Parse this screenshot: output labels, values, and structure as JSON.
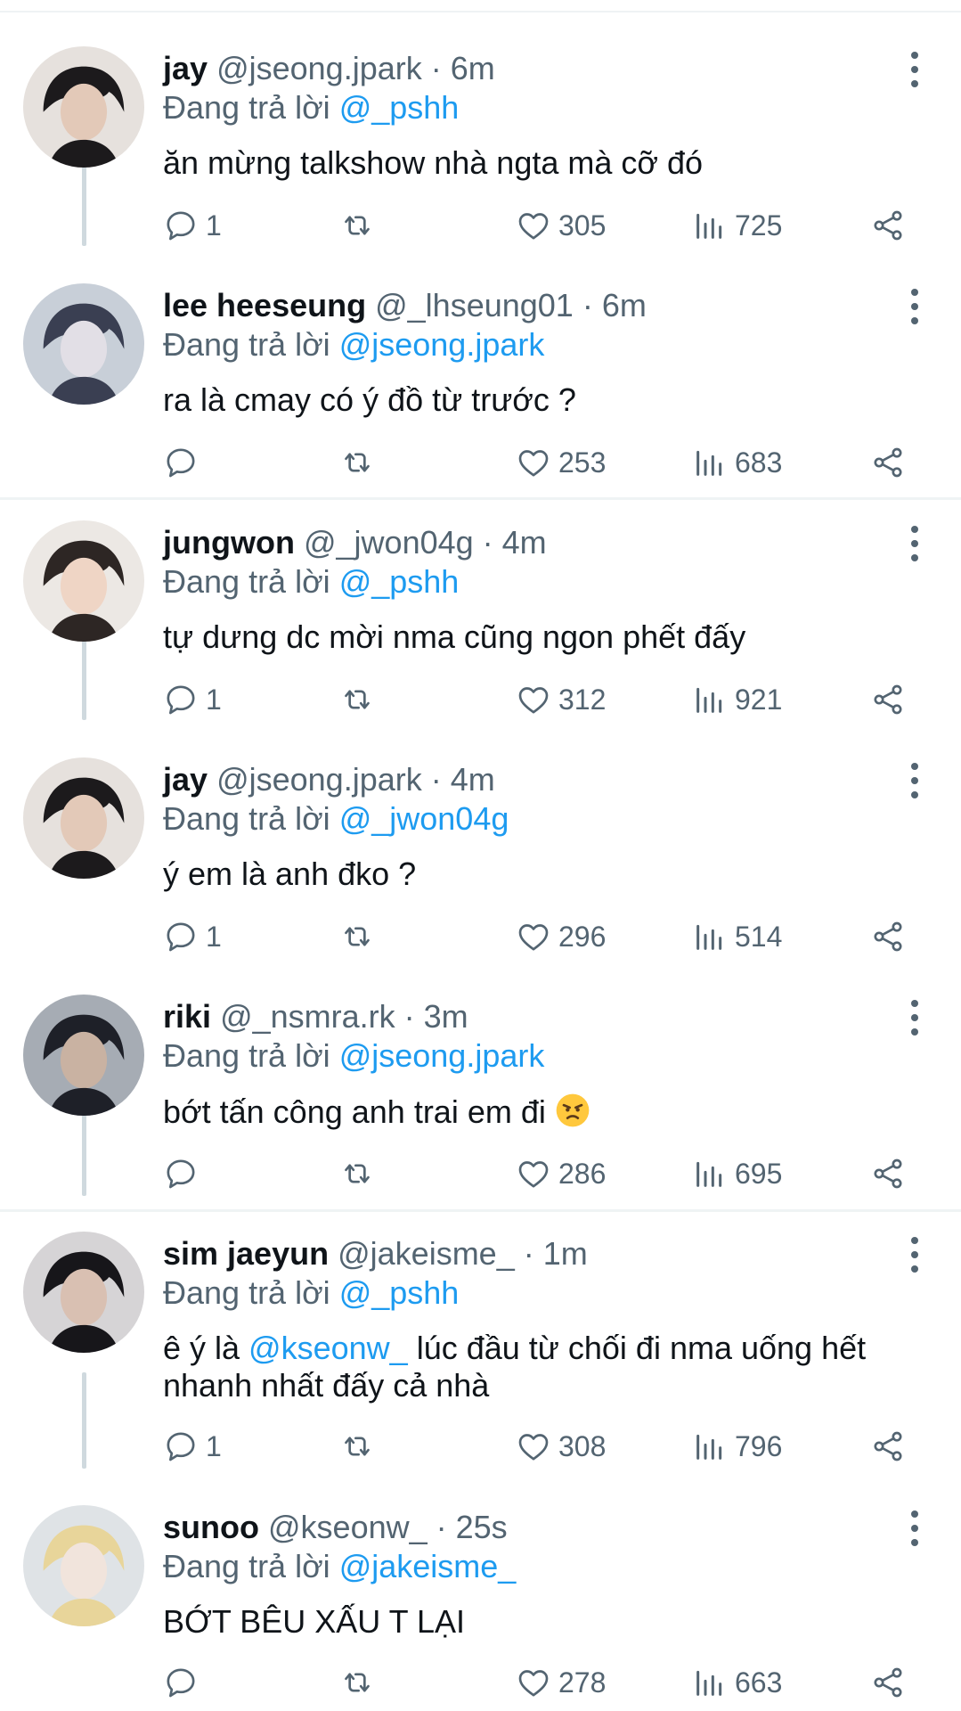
{
  "tweets": [
    {
      "name": "jay",
      "handle": "@jseong.jpark",
      "time": "6m",
      "reply_prefix": "Đang trả lời",
      "reply_to": "@_pshh",
      "text_before": "ăn mừng talkshow nhà ngta mà cỡ đó",
      "mention": "",
      "text_after": "",
      "emoji": "",
      "replies": "1",
      "likes": "305",
      "views": "725",
      "avatar_colors": [
        "#e6e1dd",
        "#1c1a1c",
        "#e3c9b8"
      ]
    },
    {
      "name": "lee heeseung",
      "handle": "@_lhseung01",
      "time": "6m",
      "reply_prefix": "Đang trả lời",
      "reply_to": "@jseong.jpark",
      "text_before": "ra là cmay có ý đồ từ trước ?",
      "mention": "",
      "text_after": "",
      "emoji": "",
      "replies": "",
      "likes": "253",
      "views": "683",
      "avatar_colors": [
        "#c8cfd8",
        "#3a3f52",
        "#e2dfe6"
      ]
    },
    {
      "name": "jungwon",
      "handle": "@_jwon04g",
      "time": "4m",
      "reply_prefix": "Đang trả lời",
      "reply_to": "@_pshh",
      "text_before": "tự dưng dc mời nma cũng ngon phết đấy",
      "mention": "",
      "text_after": "",
      "emoji": "",
      "replies": "1",
      "likes": "312",
      "views": "921",
      "avatar_colors": [
        "#ece8e4",
        "#2d2624",
        "#efd5c5"
      ]
    },
    {
      "name": "jay",
      "handle": "@jseong.jpark",
      "time": "4m",
      "reply_prefix": "Đang trả lời",
      "reply_to": "@_jwon04g",
      "text_before": "ý em là anh đko ?",
      "mention": "",
      "text_after": "",
      "emoji": "",
      "replies": "1",
      "likes": "296",
      "views": "514",
      "avatar_colors": [
        "#e6e1dd",
        "#1c1a1c",
        "#e3c9b8"
      ]
    },
    {
      "name": "riki",
      "handle": "@_nsmra.rk",
      "time": "3m",
      "reply_prefix": "Đang trả lời",
      "reply_to": "@jseong.jpark",
      "text_before": "bớt tấn công anh trai em đi",
      "mention": "",
      "text_after": "",
      "emoji": "angry-face",
      "replies": "",
      "likes": "286",
      "views": "695",
      "avatar_colors": [
        "#a6acb4",
        "#1e2028",
        "#c9b2a2"
      ]
    },
    {
      "name": "sim jaeyun",
      "handle": "@jakeisme_",
      "time": "1m",
      "reply_prefix": "Đang trả lời",
      "reply_to": "@_pshh",
      "text_before": "ê ý là ",
      "mention": "@kseonw_",
      "text_after": " lúc đầu từ chối đi nma uống hết nhanh nhất đấy cả nhà",
      "emoji": "",
      "replies": "1",
      "likes": "308",
      "views": "796",
      "avatar_colors": [
        "#d6d4d6",
        "#17161a",
        "#d9c0b2"
      ]
    },
    {
      "name": "sunoo",
      "handle": "@kseonw_",
      "time": "25s",
      "reply_prefix": "Đang trả lời",
      "reply_to": "@jakeisme_",
      "text_before": "BỚT BÊU XẤU T LẠI",
      "mention": "",
      "text_after": "",
      "emoji": "",
      "replies": "",
      "likes": "278",
      "views": "663",
      "avatar_colors": [
        "#dfe3e6",
        "#e8d59a",
        "#f1e4dc"
      ]
    }
  ],
  "colors": {
    "text": "#0f1419",
    "secondary": "#536471",
    "link": "#1d9bf0",
    "divider": "#eff3f4",
    "thread_line": "#cfd9de"
  }
}
